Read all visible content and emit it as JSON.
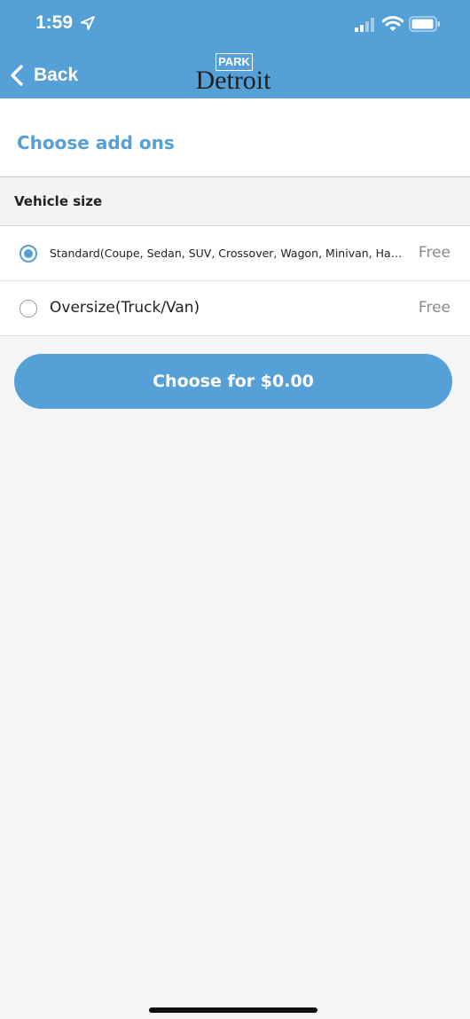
{
  "status_bar": {
    "time": "1:59"
  },
  "nav": {
    "back_label": "Back",
    "logo": {
      "park": "PARK",
      "city": "Detroit"
    }
  },
  "page": {
    "title": "Choose add ons"
  },
  "section": {
    "label": "Vehicle size"
  },
  "options": [
    {
      "label": "Standard(Coupe, Sedan, SUV, Crossover, Wagon, Minivan, Hatchback)",
      "price": "Free",
      "selected": true
    },
    {
      "label": "Oversize(Truck/Van)",
      "price": "Free",
      "selected": false
    }
  ],
  "action": {
    "choose_label": "Choose for $0.00"
  },
  "colors": {
    "accent": "#55a0d6",
    "background": "#f4f5f7"
  },
  "icons": {
    "status": [
      "location-arrow-icon",
      "cellular-signal-icon",
      "wifi-icon",
      "battery-icon"
    ],
    "nav": [
      "chevron-left-icon"
    ]
  }
}
